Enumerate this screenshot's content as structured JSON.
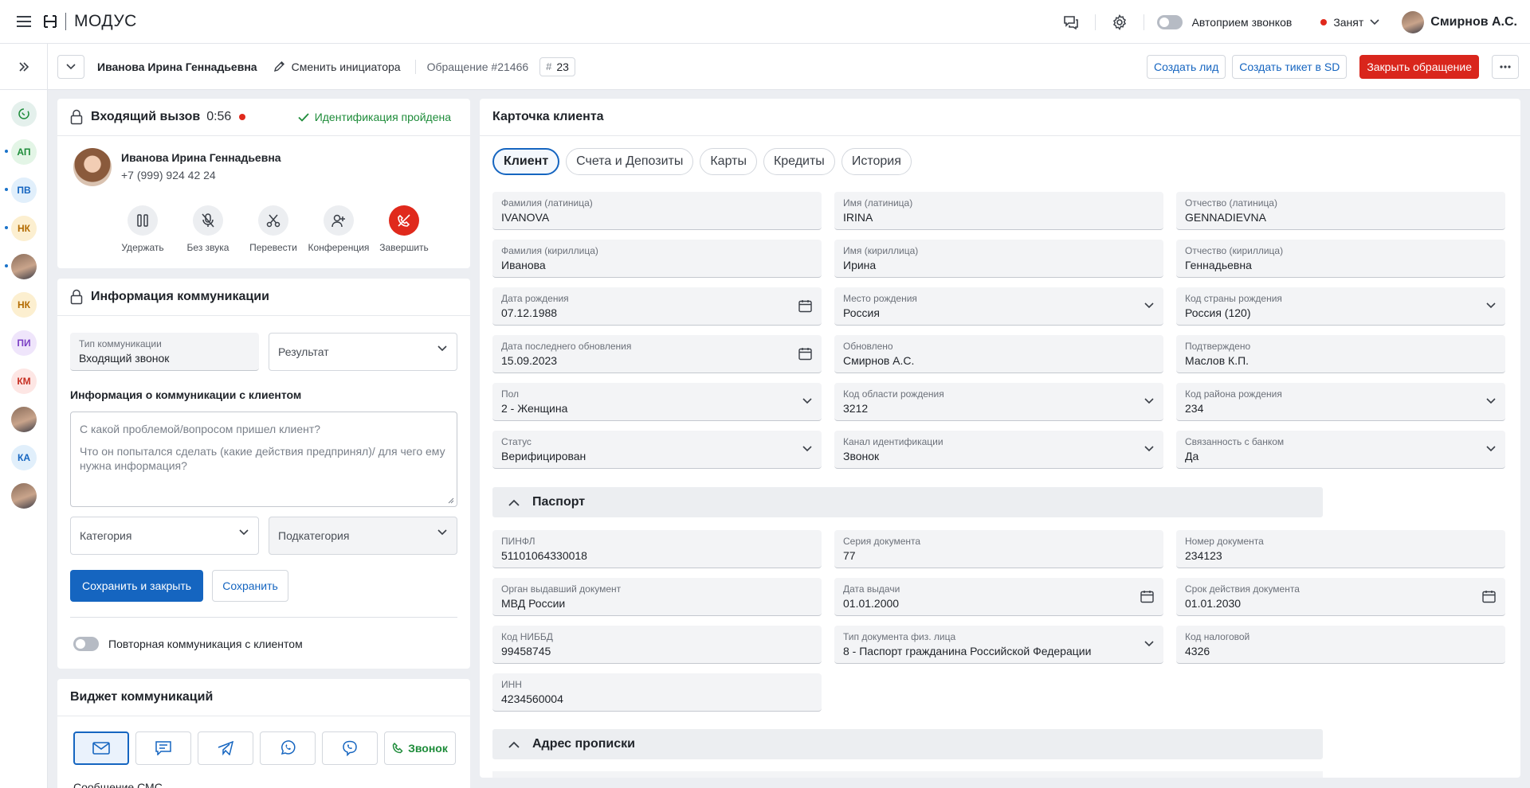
{
  "app": {
    "logo_text": "МОДУС"
  },
  "topbar": {
    "autoreceive_label": "Автоприем звонков",
    "status_label": "Занят",
    "user_name": "Смирнов А.С.",
    "colors": {
      "busy": "#e0291c"
    }
  },
  "rail": {
    "items": [
      {
        "initials": "АП",
        "bg": "#e3f5e6",
        "fg": "#1e8c3a",
        "unread": true
      },
      {
        "initials": "ПВ",
        "bg": "#e1effb",
        "fg": "#1565c0",
        "unread": true
      },
      {
        "initials": "НК",
        "bg": "#fcefd0",
        "fg": "#b36b00",
        "unread": true
      },
      {
        "initials": "",
        "photo": true,
        "unread": true
      },
      {
        "initials": "НК",
        "bg": "#fcefd0",
        "fg": "#b36b00",
        "unread": false
      },
      {
        "initials": "ПИ",
        "bg": "#efe5fb",
        "fg": "#7b3fc4",
        "unread": false
      },
      {
        "initials": "КМ",
        "bg": "#fde6e4",
        "fg": "#c62f22",
        "unread": false
      },
      {
        "initials": "",
        "photo": true,
        "unread": false
      },
      {
        "initials": "КА",
        "bg": "#e1effb",
        "fg": "#1565c0",
        "unread": false
      },
      {
        "initials": "",
        "photo": true,
        "unread": false
      }
    ]
  },
  "header": {
    "client_name": "Иванова Ирина Геннадьевна",
    "change_initiator": "Сменить инициатора",
    "ticket": "Обращение #21466",
    "count_symbol": "#",
    "count": "23",
    "create_lead": "Создать лид",
    "create_ticket": "Создать тикет в SD",
    "close_ticket": "Закрыть обращение"
  },
  "call": {
    "title": "Входящий вызов",
    "timer": "0:56",
    "identification": "Идентификация пройдена",
    "caller_name": "Иванова Ирина Геннадьевна",
    "caller_phone": "+7 (999) 924 42 24",
    "actions": [
      "Удержать",
      "Без звука",
      "Перевести",
      "Конференция",
      "Завершить"
    ]
  },
  "comm": {
    "title": "Информация коммуникации",
    "type_label": "Тип коммуникации",
    "type_value": "Входящий звонок",
    "result_placeholder": "Результат",
    "info_label": "Информация о коммуникации с клиентом",
    "textarea_line1": "С какой проблемой/вопросом пришел клиент?",
    "textarea_line2": "Что он попытался сделать (какие действия предпринял)/ для чего ему нужна информация?",
    "category_placeholder": "Категория",
    "subcategory_placeholder": "Подкатегория",
    "save_close": "Сохранить и закрыть",
    "save": "Сохранить",
    "repeat_label": "Повторная коммуникация с клиентом"
  },
  "widget": {
    "title": "Виджет коммуникаций",
    "call_label": "Звонок",
    "sms_label": "Сообщение СМС"
  },
  "card": {
    "title": "Карточка клиента",
    "tabs": [
      "Клиент",
      "Счета и Депозиты",
      "Карты",
      "Кредиты",
      "История"
    ],
    "fields": [
      {
        "label": "Фамилия (латиница)",
        "value": "IVANOVA",
        "icon": ""
      },
      {
        "label": "Имя (латиница)",
        "value": "IRINA",
        "icon": ""
      },
      {
        "label": "Отчество (латиница)",
        "value": "GENNADIEVNA",
        "icon": ""
      },
      {
        "label": "Фамилия (кириллица)",
        "value": "Иванова",
        "icon": ""
      },
      {
        "label": "Имя (кириллица)",
        "value": "Ирина",
        "icon": ""
      },
      {
        "label": "Отчество (кириллица)",
        "value": "Геннадьевна",
        "icon": ""
      },
      {
        "label": "Дата рождения",
        "value": "07.12.1988",
        "icon": "calendar"
      },
      {
        "label": "Место рождения",
        "value": "Россия",
        "icon": "chevron"
      },
      {
        "label": "Код страны рождения",
        "value": "Россия (120)",
        "icon": "chevron"
      },
      {
        "label": "Дата последнего обновления",
        "value": "15.09.2023",
        "icon": "calendar"
      },
      {
        "label": "Обновлено",
        "value": "Смирнов А.С.",
        "icon": ""
      },
      {
        "label": "Подтверждено",
        "value": "Маслов К.П.",
        "icon": ""
      },
      {
        "label": "Пол",
        "value": "2 - Женщина",
        "icon": "chevron"
      },
      {
        "label": "Код области рождения",
        "value": "3212",
        "icon": "chevron"
      },
      {
        "label": "Код района рождения",
        "value": "234",
        "icon": "chevron"
      },
      {
        "label": "Статус",
        "value": "Верифицирован",
        "icon": "chevron"
      },
      {
        "label": "Канал идентификации",
        "value": "Звонок",
        "icon": "chevron"
      },
      {
        "label": "Связанность с банком",
        "value": "Да",
        "icon": "chevron"
      }
    ],
    "passport_title": "Паспорт",
    "passport_fields": [
      {
        "label": "ПИНФЛ",
        "value": "51101064330018",
        "icon": ""
      },
      {
        "label": "Серия документа",
        "value": "77",
        "icon": ""
      },
      {
        "label": "Номер документа",
        "value": "234123",
        "icon": ""
      },
      {
        "label": "Орган выдавший документ",
        "value": "МВД России",
        "icon": ""
      },
      {
        "label": "Дата выдачи",
        "value": "01.01.2000",
        "icon": "calendar"
      },
      {
        "label": "Срок действия документа",
        "value": "01.01.2030",
        "icon": "calendar"
      },
      {
        "label": "Код НИББД",
        "value": "99458745",
        "icon": ""
      },
      {
        "label": "Тип документа физ. лица",
        "value": "8 - Паспорт гражданина Российской Федерации",
        "icon": "chevron"
      },
      {
        "label": "Код налоговой",
        "value": "4326",
        "icon": ""
      },
      {
        "label": "ИНН",
        "value": "4234560004",
        "icon": ""
      }
    ],
    "address_title": "Адрес прописки"
  }
}
